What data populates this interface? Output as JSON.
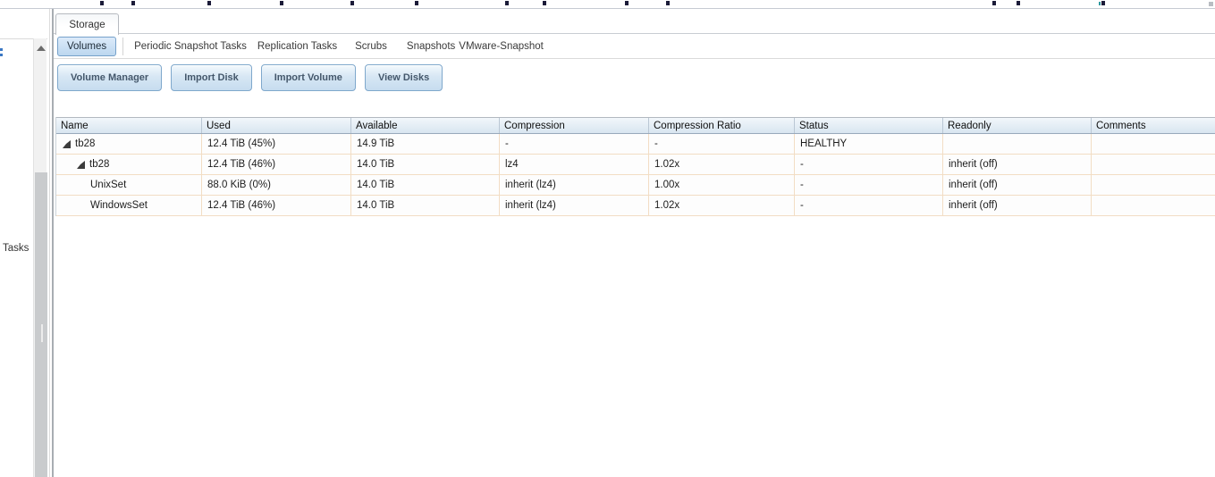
{
  "window": {
    "tab_label": "Storage"
  },
  "left_panel": {
    "tasks_label": "Tasks"
  },
  "subtabs": {
    "items": [
      {
        "label": "Volumes",
        "selected": true
      },
      {
        "label": "Periodic Snapshot Tasks",
        "selected": false
      },
      {
        "label": "Replication Tasks",
        "selected": false
      },
      {
        "label": "Scrubs",
        "selected": false
      },
      {
        "label": "Snapshots",
        "selected": false
      },
      {
        "label": "VMware-Snapshot",
        "selected": false
      }
    ]
  },
  "toolbar": {
    "buttons": [
      "Volume Manager",
      "Import Disk",
      "Import Volume",
      "View Disks"
    ]
  },
  "grid": {
    "columns": [
      "Name",
      "Used",
      "Available",
      "Compression",
      "Compression Ratio",
      "Status",
      "Readonly",
      "Comments"
    ],
    "rows": [
      {
        "name": "tb28",
        "used": "12.4 TiB (45%)",
        "available": "14.9 TiB",
        "compression": "-",
        "ratio": "-",
        "status": "HEALTHY",
        "readonly": "",
        "comments": ""
      },
      {
        "name": "tb28",
        "used": "12.4 TiB (46%)",
        "available": "14.0 TiB",
        "compression": "lz4",
        "ratio": "1.02x",
        "status": "-",
        "readonly": "inherit (off)",
        "comments": ""
      },
      {
        "name": "UnixSet",
        "used": "88.0 KiB (0%)",
        "available": "14.0 TiB",
        "compression": "inherit (lz4)",
        "ratio": "1.00x",
        "status": "-",
        "readonly": "inherit (off)",
        "comments": ""
      },
      {
        "name": "WindowsSet",
        "used": "12.4 TiB (46%)",
        "available": "14.0 TiB",
        "compression": "inherit (lz4)",
        "ratio": "1.02x",
        "status": "-",
        "readonly": "inherit (off)",
        "comments": ""
      }
    ]
  },
  "icons": {
    "tree_expando": "open-triangle",
    "scrollbar_up": "up-arrow"
  },
  "colors": {
    "subtab_selected_border": "#76a1ca",
    "subtab_selected_bg": "#c9ddf2",
    "button_border": "#7fa8cc",
    "button_text": "#44576b",
    "grid_header_bg": "#e3edf5",
    "grid_row_border": "#f2ddc4"
  }
}
